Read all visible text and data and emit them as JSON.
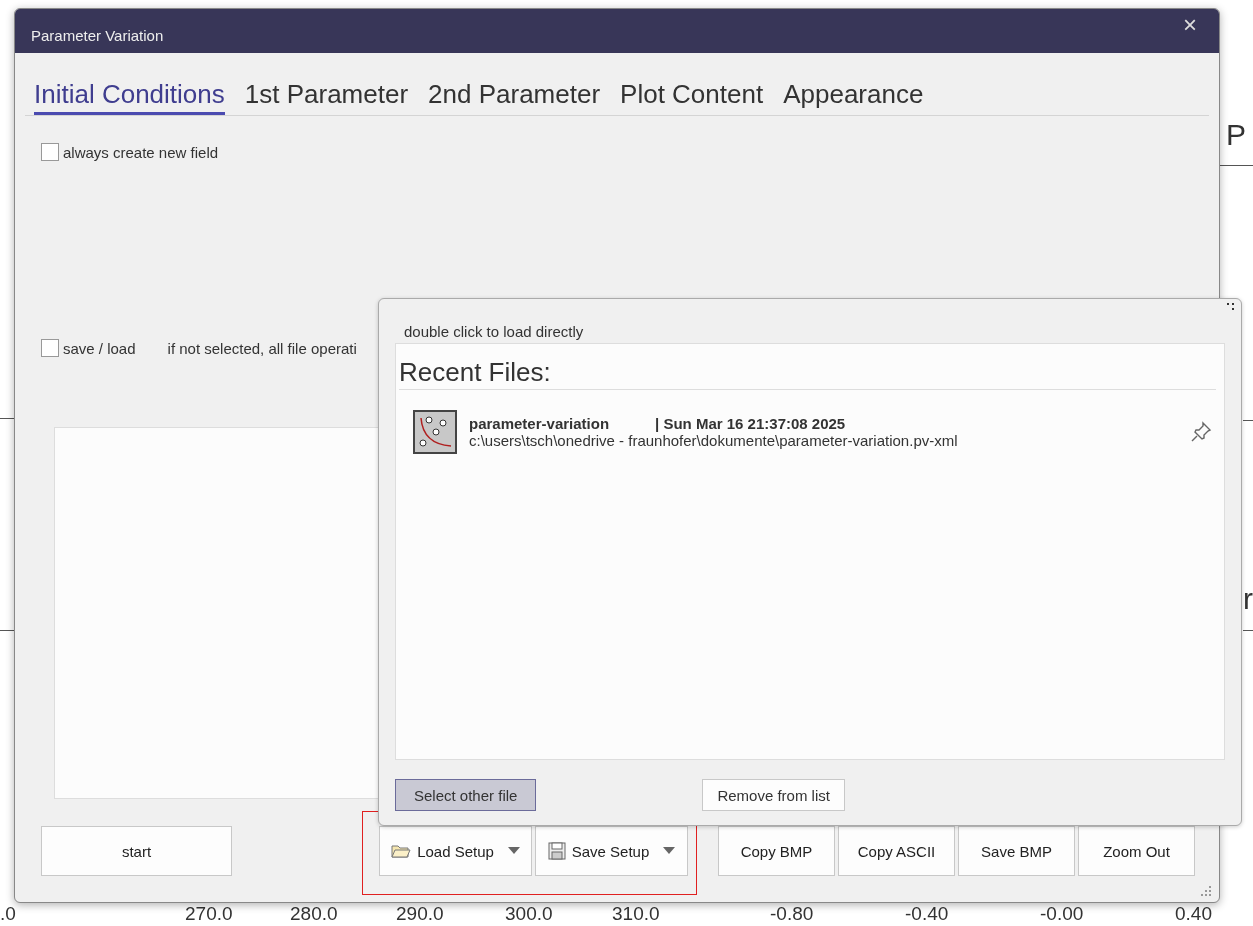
{
  "background": {
    "labels": [
      "P",
      "r"
    ],
    "axis_ticks": [
      ".0",
      "270.0",
      "280.0",
      "290.0",
      "300.0",
      "310.0",
      "-0.80",
      "-0.40",
      "-0.00",
      "0.40"
    ]
  },
  "window": {
    "title": "Parameter Variation",
    "close": "×"
  },
  "tabs": [
    {
      "label": "Initial Conditions",
      "selected": true
    },
    {
      "label": "1st Parameter",
      "selected": false
    },
    {
      "label": "2nd Parameter",
      "selected": false
    },
    {
      "label": "Plot Content",
      "selected": false
    },
    {
      "label": "Appearance",
      "selected": false
    }
  ],
  "options": [
    {
      "label": "always create new field",
      "checked": false
    },
    {
      "label": "save / load",
      "checked": false,
      "note": "if not selected, all file operati"
    }
  ],
  "buttons": [
    {
      "label": "start",
      "kind": "plain"
    },
    {
      "label": "Load Setup",
      "kind": "load"
    },
    {
      "label": "Save Setup",
      "kind": "save"
    },
    {
      "label": "Copy BMP",
      "kind": "plain"
    },
    {
      "label": "Copy ASCII",
      "kind": "plain"
    },
    {
      "label": "Save BMP",
      "kind": "plain"
    },
    {
      "label": "Zoom Out",
      "kind": "plain"
    }
  ],
  "recent_popup": {
    "hint": "double click to load directly",
    "heading": "Recent Files:",
    "files": [
      {
        "name": "parameter-variation",
        "date": "| Sun Mar 16 21:37:08 2025",
        "path": "c:\\users\\tsch\\onedrive - fraunhofer\\dokumente\\parameter-variation.pv-xml",
        "pinned": false
      }
    ],
    "buttons": [
      {
        "label": "Select other file",
        "selected": true
      },
      {
        "label": "Remove from list",
        "selected": false
      }
    ]
  }
}
